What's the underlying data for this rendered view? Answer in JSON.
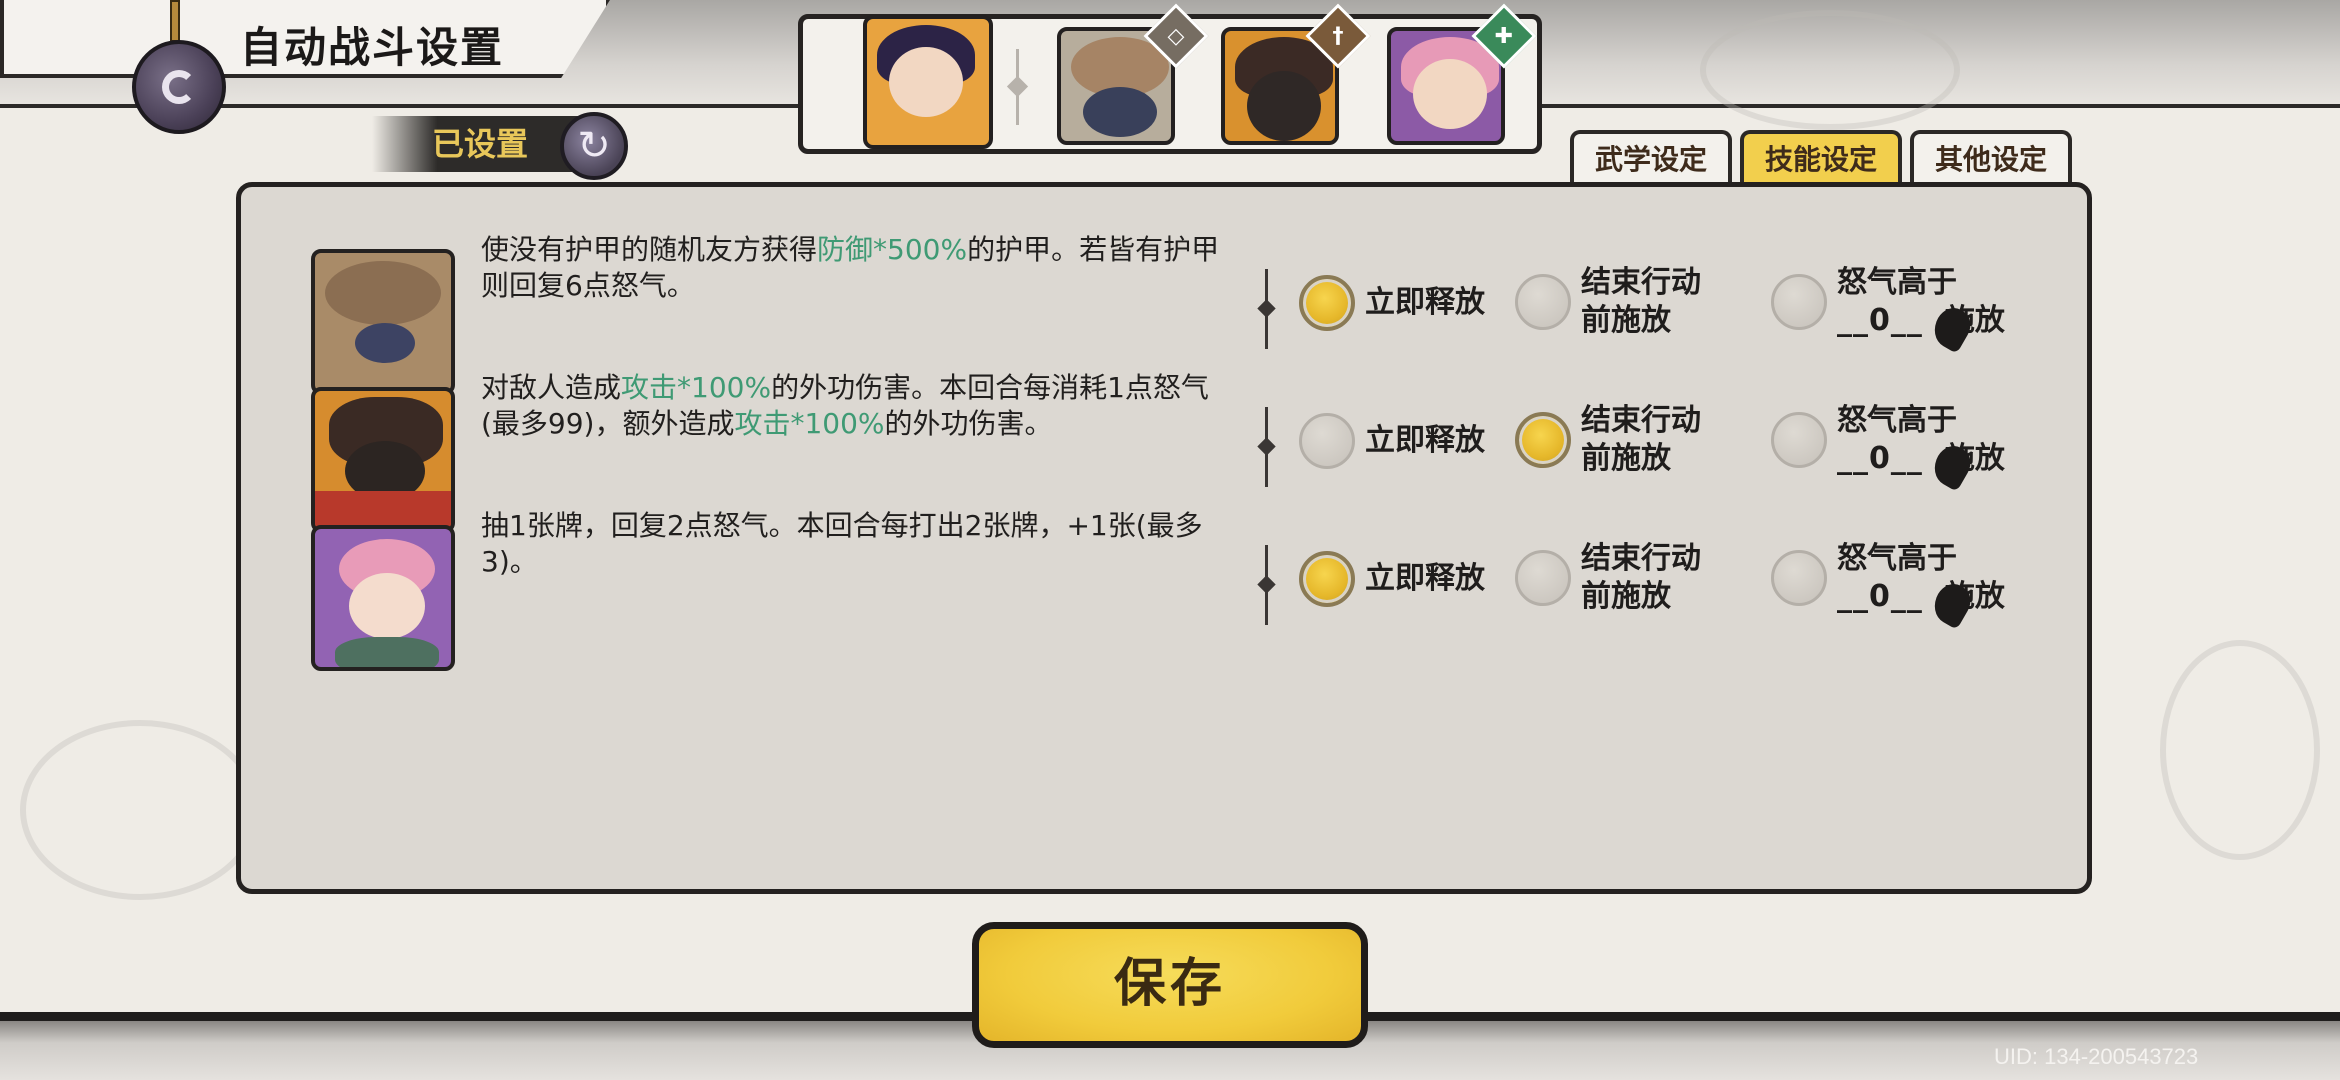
{
  "header": {
    "title": "自动战斗设置",
    "set_tag": "已设置"
  },
  "heroes": [
    {
      "name": "hero-leader",
      "badge": ""
    },
    {
      "name": "hero-shield",
      "badge": "shield-icon"
    },
    {
      "name": "hero-sword",
      "badge": "sword-icon"
    },
    {
      "name": "hero-support",
      "badge": "heal-icon"
    }
  ],
  "tabs": [
    {
      "label": "武学设定",
      "active": false
    },
    {
      "label": "技能设定",
      "active": true
    },
    {
      "label": "其他设定",
      "active": false
    }
  ],
  "skills": [
    {
      "desc_parts": [
        "使没有护甲的随机友方获得",
        "防御*500%",
        "的护甲。若皆有护甲则回复6点怒气。"
      ],
      "options": [
        "立即释放",
        "结束行动前施放",
        "怒气高于"
      ],
      "rage_value": "__0__",
      "rage_suffix": "施放",
      "selected": 0
    },
    {
      "desc_parts": [
        "对敌人造成",
        "攻击*100%",
        "的外功伤害。本回合每消耗1点怒气(最多99)，额外造成",
        "攻击*100%",
        "的外功伤害。"
      ],
      "options": [
        "立即释放",
        "结束行动前施放",
        "怒气高于"
      ],
      "rage_value": "__0__",
      "rage_suffix": "施放",
      "selected": 1
    },
    {
      "desc_parts": [
        "抽1张牌，回复2点怒气。本回合每打出2张牌，+1张(最多3)。"
      ],
      "options": [
        "立即释放",
        "结束行动前施放",
        "怒气高于"
      ],
      "rage_value": "__0__",
      "rage_suffix": "施放",
      "selected": 0
    }
  ],
  "option_labels": {
    "immediate": "立即释放",
    "end_line1": "结束行动",
    "end_line2": "前施放",
    "rage_line1": "怒气高于",
    "rage_value": "__0__",
    "rage_suffix": "施放"
  },
  "footer": {
    "save_label": "保存",
    "uid": "UID:  134-200543723"
  },
  "colors": {
    "accent_yellow": "#f2cf4d",
    "highlight_green": "#3f9a74",
    "panel_bg": "#dcd8d2"
  }
}
